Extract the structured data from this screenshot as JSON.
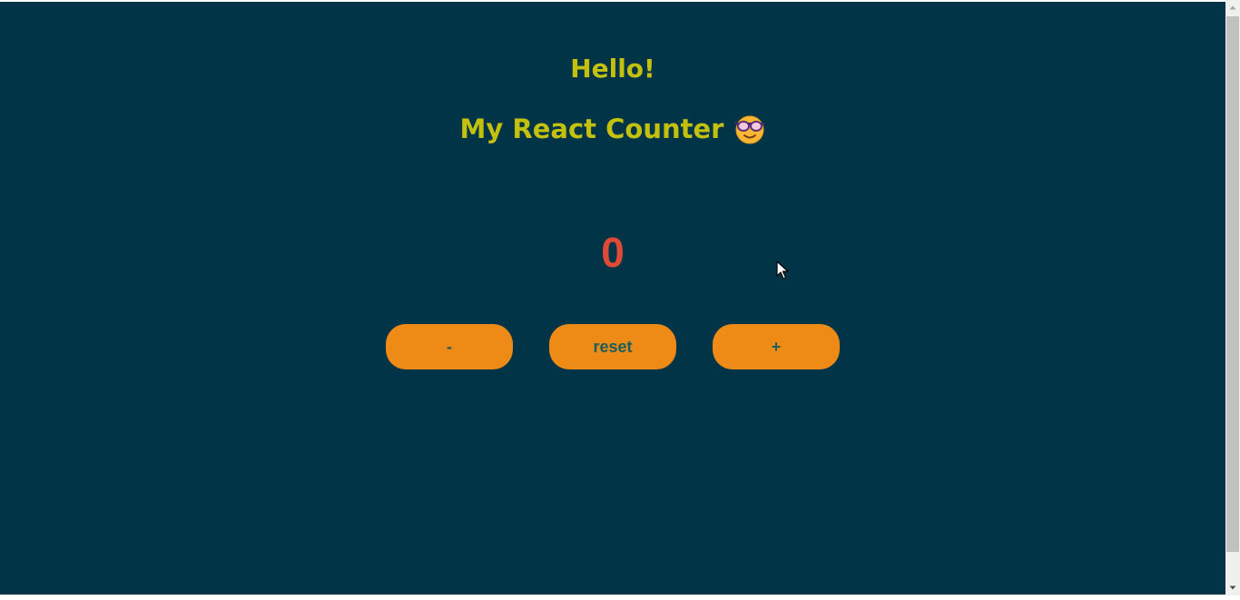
{
  "page": {
    "background": "#003446",
    "title_color": "#c3c10e",
    "counter_color": "#df4a36",
    "button_color": "#ee8a16",
    "button_text_color": "#1e5d5a"
  },
  "header": {
    "greeting": "Hello!",
    "subtitle": "My React Counter",
    "subtitle_emoji": "smiling-face-with-sunglasses-emoji"
  },
  "counter": {
    "value": "0"
  },
  "controls": {
    "decrement_label": "-",
    "reset_label": "reset",
    "increment_label": "+"
  },
  "scrollbar": {
    "up_icon": "scroll-up-arrow-icon",
    "down_icon": "scroll-down-arrow-icon"
  }
}
